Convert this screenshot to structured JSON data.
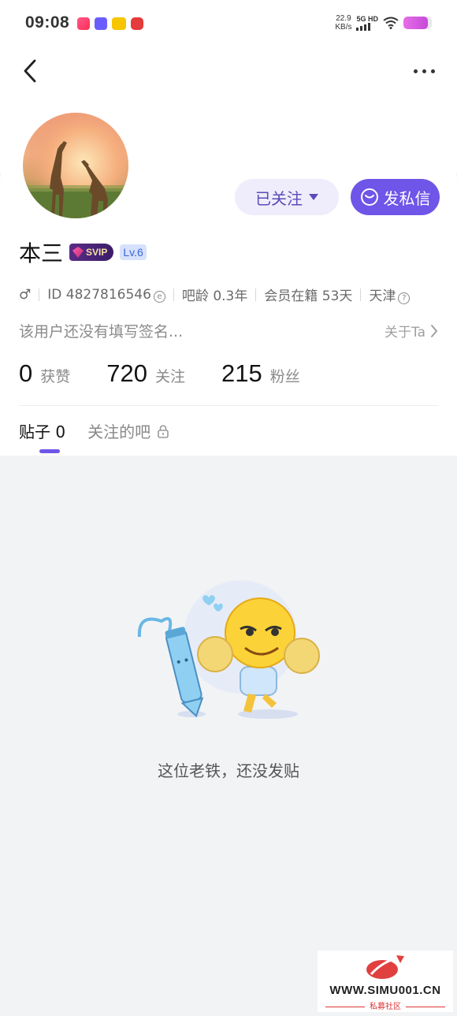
{
  "status_bar": {
    "time": "09:08",
    "speed_value": "22.9",
    "speed_unit": "KB/s",
    "network": "5G HD",
    "battery_fraction": 0.85,
    "battery_color": "#d84fd8"
  },
  "profile": {
    "name": "本三",
    "vip_label": "SVIP",
    "level": "Lv.6",
    "gender_symbol": "♂",
    "id_text": "ID 4827816546",
    "bar_age": "吧龄 0.3年",
    "member_days": "会员在籍 53天",
    "location": "天津",
    "signature": "该用户还没有填写签名...",
    "about_label": "关于Ta"
  },
  "actions": {
    "followed_label": "已关注",
    "message_label": "发私信"
  },
  "stats": [
    {
      "num": "0",
      "label": "获赞"
    },
    {
      "num": "720",
      "label": "关注"
    },
    {
      "num": "215",
      "label": "粉丝"
    }
  ],
  "tabs": [
    {
      "label": "贴子 0"
    },
    {
      "label": "关注的吧"
    }
  ],
  "empty_state": {
    "text": "这位老铁，还没发贴"
  },
  "watermark": {
    "url": "WWW.SIMU001.CN",
    "subtitle": "私募社区"
  },
  "colors": {
    "accent": "#6f55e8",
    "follow_bg": "#efedfb"
  }
}
